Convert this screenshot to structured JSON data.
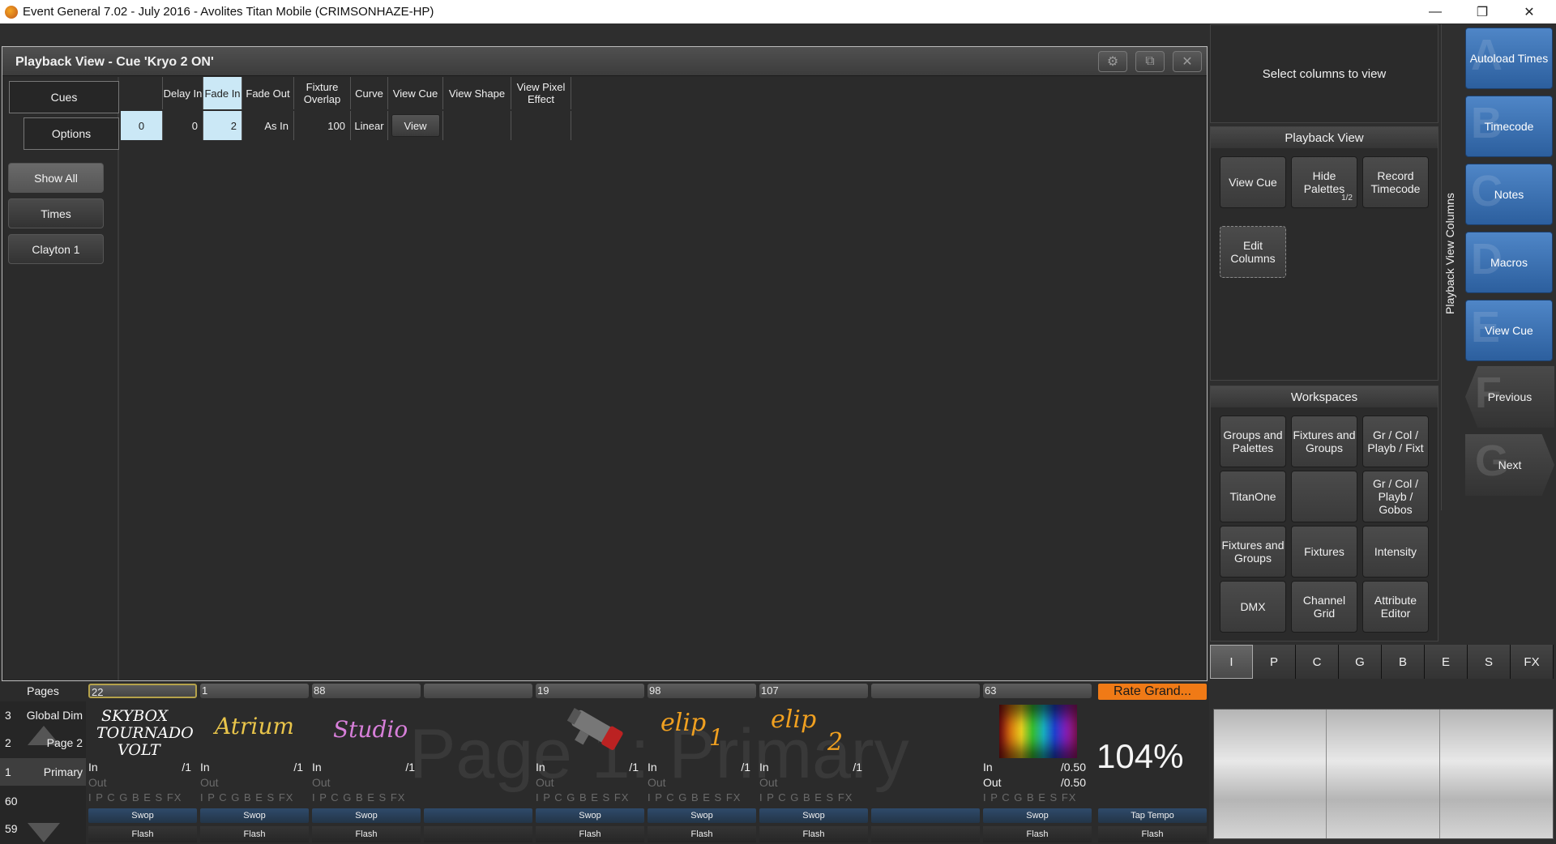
{
  "titlebar": {
    "title": "Event General 7.02 - July 2016 - Avolites Titan Mobile (CRIMSONHAZE-HP)"
  },
  "playback_view": {
    "title": "Playback View - Cue 'Kryo 2 ON'",
    "tabs": [
      "Cues",
      "Options"
    ],
    "side_buttons": [
      "Show All",
      "Times",
      "Clayton 1"
    ],
    "columns": [
      "",
      "Delay In",
      "Fade In",
      "Fade Out",
      "Fixture Overlap",
      "Curve",
      "View Cue",
      "View Shape",
      "View Pixel Effect"
    ],
    "row": {
      "cue": "0",
      "delay_in": "0",
      "fade_in": "2",
      "fade_out": "As In",
      "fixture_overlap": "100",
      "curve": "Linear",
      "view_cue": "View",
      "view_shape": "",
      "view_pixel_effect": ""
    }
  },
  "right_panel": {
    "prompt": "Select columns to view",
    "playback_view_title": "Playback View",
    "playback_view_buttons": [
      {
        "label": "View Cue",
        "badge": ""
      },
      {
        "label": "Hide Palettes",
        "badge": "1/2"
      },
      {
        "label": "Record Timecode",
        "badge": ""
      },
      {
        "label": "Edit Columns",
        "badge": ""
      }
    ],
    "workspaces_title": "Workspaces",
    "workspace_buttons": [
      "Groups and Palettes",
      "Fixtures and Groups",
      "Gr / Col / Playb / Fixt",
      "TitanOne",
      "",
      "Gr / Col / Playb / Gobos",
      "Fixtures and Groups",
      "Fixtures",
      "Intensity",
      "DMX",
      "Channel Grid",
      "Attribute Editor"
    ],
    "vertical_label": "Playback View Columns",
    "letter_tabs": [
      "I",
      "P",
      "C",
      "G",
      "B",
      "E",
      "S",
      "FX"
    ]
  },
  "softkeys": [
    {
      "letter": "A",
      "label": "Autoload Times"
    },
    {
      "letter": "B",
      "label": "Timecode"
    },
    {
      "letter": "C",
      "label": "Notes"
    },
    {
      "letter": "D",
      "label": "Macros"
    },
    {
      "letter": "E",
      "label": "View Cue"
    },
    {
      "letter": "F",
      "label": "Previous"
    },
    {
      "letter": "G",
      "label": "Next"
    }
  ],
  "pages": {
    "title": "Pages",
    "items": [
      {
        "num": "3",
        "name": "Global Dim"
      },
      {
        "num": "2",
        "name": "Page 2"
      },
      {
        "num": "1",
        "name": "Primary"
      },
      {
        "num": "60",
        "name": ""
      },
      {
        "num": "59",
        "name": ""
      }
    ]
  },
  "playbacks": [
    {
      "label": "22",
      "art": "SKYBOX TOURNADO VOLT",
      "in": "In",
      "in_val": "/1",
      "out": "Out",
      "out_val": "",
      "flags": "I P C G B E S FX",
      "swop": "Swop",
      "flash": "Flash"
    },
    {
      "label": "1",
      "art": "Atrium",
      "in": "In",
      "in_val": "/1",
      "out": "Out",
      "out_val": "",
      "flags": "I P C G B E S FX",
      "swop": "Swop",
      "flash": "Flash"
    },
    {
      "label": "88",
      "art": "Studio",
      "in": "In",
      "in_val": "/1",
      "out": "Out",
      "out_val": "",
      "flags": "I P C G B E S FX",
      "swop": "Swop",
      "flash": "Flash"
    },
    {
      "label": "",
      "art": "",
      "in": "",
      "in_val": "",
      "out": "",
      "out_val": "",
      "flags": "",
      "swop": "",
      "flash": ""
    },
    {
      "label": "19",
      "art": "",
      "in": "In",
      "in_val": "/1",
      "out": "Out",
      "out_val": "",
      "flags": "I P C G B E S FX",
      "swop": "Swop",
      "flash": "Flash"
    },
    {
      "label": "98",
      "art": "elip 1",
      "in": "In",
      "in_val": "/1",
      "out": "Out",
      "out_val": "",
      "flags": "I P C G B E S FX",
      "swop": "Swop",
      "flash": "Flash"
    },
    {
      "label": "107",
      "art": "elip 2",
      "in": "In",
      "in_val": "/1",
      "out": "Out",
      "out_val": "",
      "flags": "I P C G B E S FX",
      "swop": "Swop",
      "flash": "Flash"
    },
    {
      "label": "",
      "art": "",
      "in": "",
      "in_val": "",
      "out": "",
      "out_val": "",
      "flags": "",
      "swop": "",
      "flash": ""
    },
    {
      "label": "63",
      "art": "",
      "in": "In",
      "in_val": "/0.50",
      "out": "Out",
      "out_val": "/0.50",
      "flags": "I P C G B E S FX",
      "swop": "Swop",
      "flash": "Flash"
    }
  ],
  "rate": {
    "label": "Rate Grand...",
    "value": "104%",
    "tap": "Tap Tempo",
    "flash": "Flash"
  },
  "watermark": "Page 1: Primary",
  "colors": {
    "accent": "#f07a16",
    "selected_cell": "#cbe8f6",
    "softkey_blue": "#3a6fb0"
  }
}
